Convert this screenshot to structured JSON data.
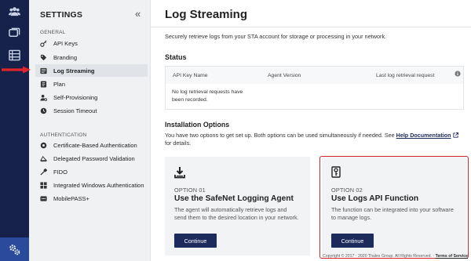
{
  "rail": {
    "icons": [
      "users-icon",
      "windows-icon",
      "list-icon"
    ],
    "bottom_icon": "settings-gear-icon"
  },
  "sidebar": {
    "title": "SETTINGS",
    "collapse_glyph": "«",
    "general_label": "GENERAL",
    "general_items": [
      {
        "label": "API Keys",
        "icon": "key-icon"
      },
      {
        "label": "Branding",
        "icon": "tag-icon"
      },
      {
        "label": "Log Streaming",
        "icon": "stream-icon",
        "active": true
      },
      {
        "label": "Plan",
        "icon": "plan-icon"
      },
      {
        "label": "Self-Provisioning",
        "icon": "user-gear-icon"
      },
      {
        "label": "Session Timeout",
        "icon": "clock-icon"
      }
    ],
    "auth_label": "AUTHENTICATION",
    "auth_items": [
      {
        "label": "Certificate-Based Authentication",
        "icon": "certificate-icon"
      },
      {
        "label": "Delegated Password Validation",
        "icon": "delegated-icon"
      },
      {
        "label": "FIDO",
        "icon": "fido-key-icon"
      },
      {
        "label": "Integrated Windows Authentication",
        "icon": "windows-auth-icon"
      },
      {
        "label": "MobilePASS+",
        "icon": "mobile-icon"
      }
    ]
  },
  "main": {
    "title": "Log Streaming",
    "intro": "Securely retrieve logs from your STA account for storage or processing in your network.",
    "status": {
      "heading": "Status",
      "columns": [
        "API Key Name",
        "Agent Version",
        "Last log retrieval request"
      ],
      "empty_line1": "No log retrieval requests have",
      "empty_line2": "been recorded."
    },
    "install": {
      "heading": "Installation Options",
      "desc_prefix": "You have two options to get set up. Both options can be used simultaneously if needed. See ",
      "desc_link": "Help Documentation",
      "desc_suffix": "for details."
    },
    "options": [
      {
        "icon": "download-icon",
        "number": "OPTION 01",
        "name": "Use the SafeNet Logging Agent",
        "desc": "The agent will automatically retrieve logs and send them to the desired location in your network.",
        "button": "Continue"
      },
      {
        "icon": "api-function-icon",
        "number": "OPTION 02",
        "name": "Use Logs API Function",
        "desc": "The function can be integrated into your software to manage logs.",
        "button": "Continue"
      }
    ]
  },
  "footer": {
    "copyright": "Copyright © 2017 - 2020 Thales Group. All Rights Reserved. - ",
    "terms": "Terms of Service"
  },
  "colors": {
    "rail": "#16224a",
    "rail_accent": "#2a4b9b",
    "primary_button": "#1d2b5c",
    "highlight_border": "#d6262b",
    "pointer_arrow": "#e0262b"
  }
}
